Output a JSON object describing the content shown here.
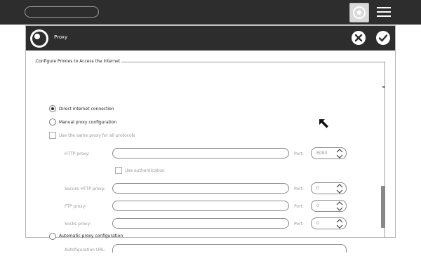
{
  "topbar": {
    "search_value": "",
    "settings_icon": "circle-target-icon",
    "menu_icon": "hamburger-menu-icon"
  },
  "dialog": {
    "title": "Proxy",
    "cancel_icon": "close-circle-icon",
    "confirm_icon": "checkmark-circle-icon"
  },
  "form": {
    "legend": "Configure Proxies to Access the Internet",
    "options": {
      "direct": "Direct internet connection",
      "manual": "Manual proxy configuration",
      "auto": "Automatic proxy configuration"
    },
    "selected_option": "direct",
    "same_proxy_label": "Use the same proxy for all protocols",
    "use_auth_label": "Use authentication",
    "fields": {
      "http": {
        "label": "HTTP proxy:",
        "value": "",
        "port_label": "Port:",
        "port_value": "8080"
      },
      "secure_http": {
        "label": "Secure HTTP proxy:",
        "value": "",
        "port_label": "Port:",
        "port_value": "0"
      },
      "ftp": {
        "label": "FTP proxy:",
        "value": "",
        "port_label": "Port:",
        "port_value": "0"
      },
      "socks": {
        "label": "Socks proxy:",
        "value": "",
        "port_label": "Port:",
        "port_value": "0"
      }
    },
    "autoconfig_label": "Autofiguration URL:"
  }
}
